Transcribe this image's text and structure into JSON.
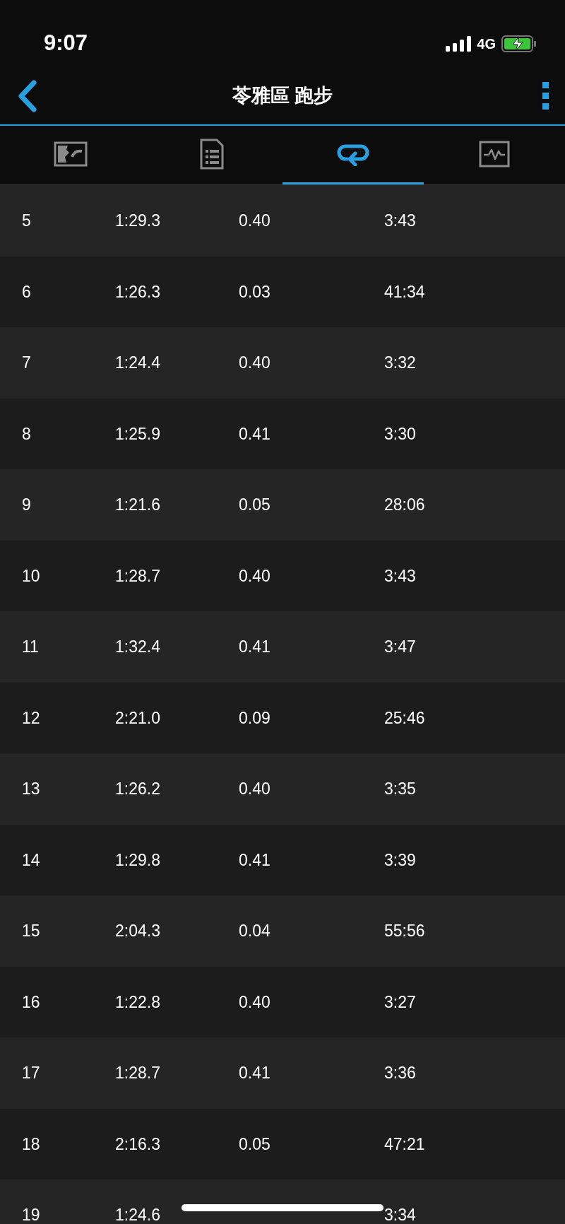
{
  "status_bar": {
    "time": "9:07",
    "network": "4G"
  },
  "nav": {
    "title": "苓雅區 跑步"
  },
  "tabs": [
    {
      "kind": "map",
      "selected": false
    },
    {
      "kind": "details",
      "selected": false
    },
    {
      "kind": "laps",
      "selected": true
    },
    {
      "kind": "charts",
      "selected": false
    }
  ],
  "laps": [
    {
      "column_1": "5",
      "column_2": "1:29.3",
      "column_3": "0.40",
      "column_4": "3:43"
    },
    {
      "column_1": "6",
      "column_2": "1:26.3",
      "column_3": "0.03",
      "column_4": "41:34"
    },
    {
      "column_1": "7",
      "column_2": "1:24.4",
      "column_3": "0.40",
      "column_4": "3:32"
    },
    {
      "column_1": "8",
      "column_2": "1:25.9",
      "column_3": "0.41",
      "column_4": "3:30"
    },
    {
      "column_1": "9",
      "column_2": "1:21.6",
      "column_3": "0.05",
      "column_4": "28:06"
    },
    {
      "column_1": "10",
      "column_2": "1:28.7",
      "column_3": "0.40",
      "column_4": "3:43"
    },
    {
      "column_1": "11",
      "column_2": "1:32.4",
      "column_3": "0.41",
      "column_4": "3:47"
    },
    {
      "column_1": "12",
      "column_2": "2:21.0",
      "column_3": "0.09",
      "column_4": "25:46"
    },
    {
      "column_1": "13",
      "column_2": "1:26.2",
      "column_3": "0.40",
      "column_4": "3:35"
    },
    {
      "column_1": "14",
      "column_2": "1:29.8",
      "column_3": "0.41",
      "column_4": "3:39"
    },
    {
      "column_1": "15",
      "column_2": "2:04.3",
      "column_3": "0.04",
      "column_4": "55:56"
    },
    {
      "column_1": "16",
      "column_2": "1:22.8",
      "column_3": "0.40",
      "column_4": "3:27"
    },
    {
      "column_1": "17",
      "column_2": "1:28.7",
      "column_3": "0.41",
      "column_4": "3:36"
    },
    {
      "column_1": "18",
      "column_2": "2:16.3",
      "column_3": "0.05",
      "column_4": "47:21"
    },
    {
      "column_1": "19",
      "column_2": "1:24.6",
      "column_4": "3:34"
    }
  ]
}
